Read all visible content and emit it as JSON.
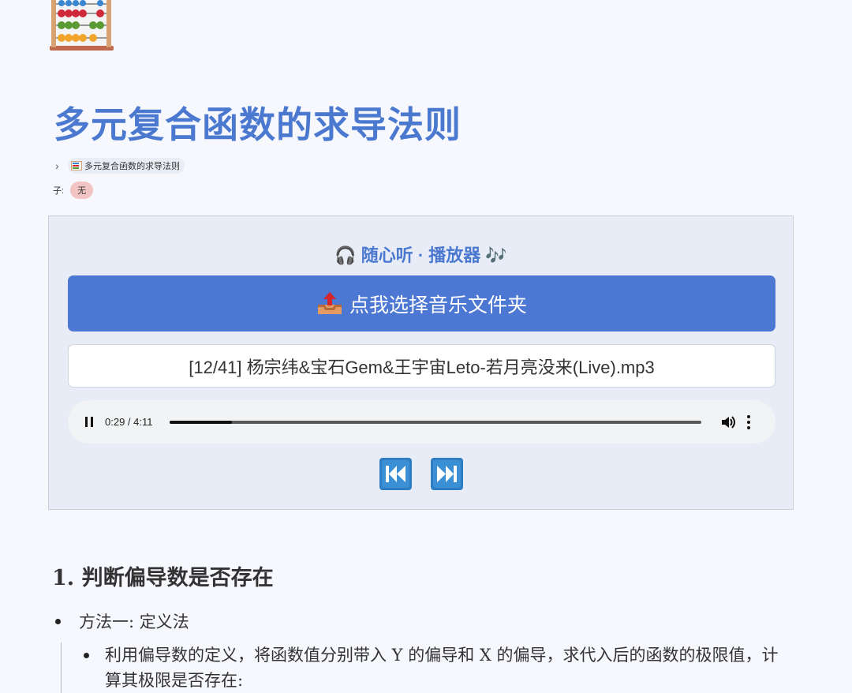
{
  "page": {
    "title": "多元复合函数的求导法则"
  },
  "breadcrumb": {
    "item": "多元复合函数的求导法则"
  },
  "children": {
    "label": "子:",
    "value": "无"
  },
  "player": {
    "title": "🎧 随心听 · 播放器 🎶",
    "select_folder_label": "点我选择音乐文件夹",
    "track_label": "[12/41] 杨宗纬&宝石Gem&王宇宙Leto-若月亮没来(Live).mp3",
    "time": "0:29 / 4:11",
    "progress": 0.116,
    "state": "playing"
  },
  "content": {
    "section_heading": "1. 判断偏导数是否存在",
    "item1": "方法一: 定义法",
    "item1_sub": "利用偏导数的定义，将函数值分别带入 Y 的偏导和 X 的偏导，求代入后的函数的极限值，计算其极限是否存在:"
  },
  "colors": {
    "accent": "#4c77d3",
    "page_bg": "#f6f8fe",
    "player_bg": "#e8ecf6",
    "none_pill": "#f2c4c4"
  }
}
